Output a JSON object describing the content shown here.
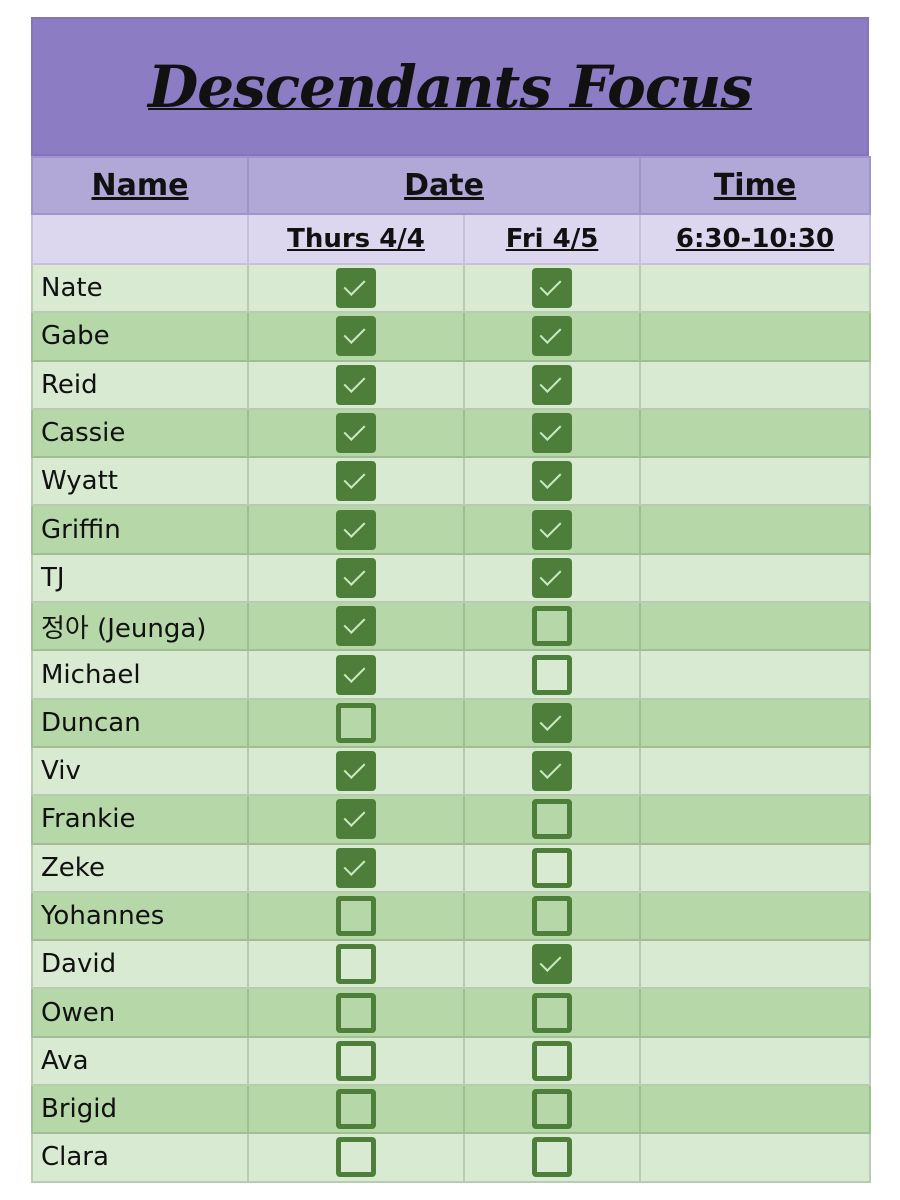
{
  "title": "Descendants Focus",
  "header": {
    "name": "Name",
    "date": "Date",
    "time": "Time",
    "day1": "Thurs 4/4",
    "day2": "Fri 4/5",
    "time_range": "6:30-10:30"
  },
  "colors": {
    "title_bg": "#8b7cc4",
    "header_bg": "#b1a8d8",
    "subheader_bg": "#dcd6ee",
    "row_light": "#d8ead2",
    "row_dark": "#b6d7a8",
    "checkbox": "#4e7f3a"
  },
  "rows": [
    {
      "name": "Nate",
      "thurs": true,
      "fri": true
    },
    {
      "name": "Gabe",
      "thurs": true,
      "fri": true
    },
    {
      "name": "Reid",
      "thurs": true,
      "fri": true
    },
    {
      "name": "Cassie",
      "thurs": true,
      "fri": true
    },
    {
      "name": "Wyatt",
      "thurs": true,
      "fri": true
    },
    {
      "name": "Griffin",
      "thurs": true,
      "fri": true
    },
    {
      "name": "TJ",
      "thurs": true,
      "fri": true
    },
    {
      "name": "정아 (Jeunga)",
      "thurs": true,
      "fri": false
    },
    {
      "name": "Michael",
      "thurs": true,
      "fri": false
    },
    {
      "name": "Duncan",
      "thurs": false,
      "fri": true
    },
    {
      "name": "Viv",
      "thurs": true,
      "fri": true
    },
    {
      "name": "Frankie",
      "thurs": true,
      "fri": false
    },
    {
      "name": "Zeke",
      "thurs": true,
      "fri": false
    },
    {
      "name": "Yohannes",
      "thurs": false,
      "fri": false
    },
    {
      "name": "David",
      "thurs": false,
      "fri": true
    },
    {
      "name": "Owen",
      "thurs": false,
      "fri": false
    },
    {
      "name": "Ava",
      "thurs": false,
      "fri": false
    },
    {
      "name": "Brigid",
      "thurs": false,
      "fri": false
    },
    {
      "name": "Clara",
      "thurs": false,
      "fri": false
    }
  ]
}
